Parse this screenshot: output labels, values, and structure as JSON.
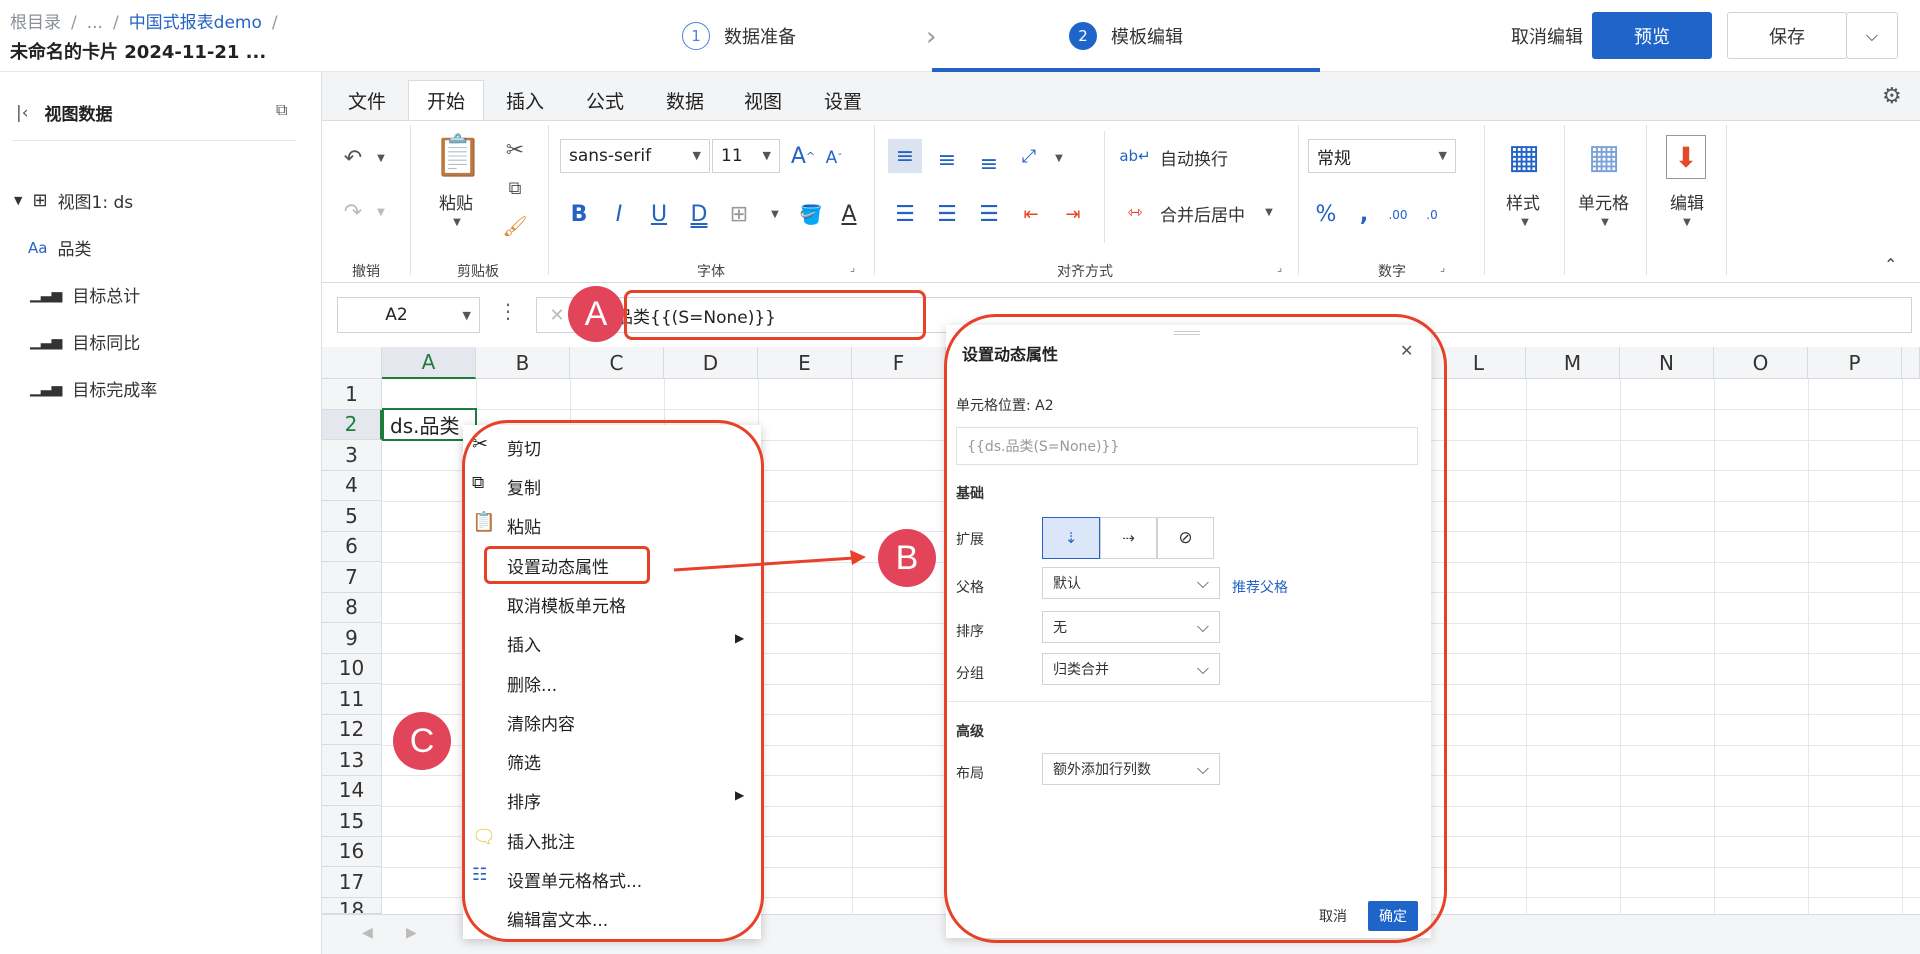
{
  "topbar": {
    "breadcrumb": [
      "根目录",
      "...",
      "中国式报表demo"
    ],
    "separator": "/",
    "title": "未命名的卡片 2024-11-21 ...",
    "steps": [
      {
        "num": "1",
        "label": "数据准备"
      },
      {
        "num": "2",
        "label": "模板编辑"
      }
    ],
    "cancel_edit": "取消编辑",
    "preview": "预览",
    "save": "保存"
  },
  "sidebar": {
    "title": "视图数据",
    "view_node": "视图1: ds",
    "fields": [
      "品类",
      "目标总计",
      "目标同比",
      "目标完成率"
    ]
  },
  "tabs": [
    "文件",
    "开始",
    "插入",
    "公式",
    "数据",
    "视图",
    "设置"
  ],
  "ribbon": {
    "undo_group": "撤销",
    "clipboard_group": "剪贴板",
    "paste": "粘贴",
    "font_group": "字体",
    "font_family": "sans-serif",
    "font_size": "11",
    "align_group": "对齐方式",
    "wrap_text": "自动换行",
    "merge_center": "合并后居中",
    "number_group": "数字",
    "number_format": "常规",
    "style": "样式",
    "cell": "单元格",
    "edit": "编辑"
  },
  "formula_bar": {
    "cell_ref": "A2",
    "formula": "ds.品类{{(S=None)}}"
  },
  "grid": {
    "columns": [
      "A",
      "B",
      "C",
      "D",
      "E",
      "F",
      "L",
      "M",
      "N",
      "O",
      "P"
    ],
    "rows": [
      "1",
      "2",
      "3",
      "4",
      "5",
      "6",
      "7",
      "8",
      "9",
      "10",
      "11",
      "12",
      "13",
      "14",
      "15",
      "16",
      "17",
      "18"
    ],
    "cell_a2": "ds.品类"
  },
  "context_menu": [
    "剪切",
    "复制",
    "粘贴",
    "设置动态属性",
    "取消模板单元格",
    "插入",
    "删除...",
    "清除内容",
    "筛选",
    "排序",
    "插入批注",
    "设置单元格格式...",
    "编辑富文本..."
  ],
  "dialog": {
    "title": "设置动态属性",
    "cell_position": "单元格位置: A2",
    "expression": "{{ds.品类(S=None)}}",
    "basic": "基础",
    "expand_label": "扩展",
    "parent_label": "父格",
    "parent_value": "默认",
    "recommend_parent": "推荐父格",
    "sort_label": "排序",
    "sort_value": "无",
    "group_label": "分组",
    "group_value": "归类合并",
    "advanced": "高级",
    "layout_label": "布局",
    "layout_value": "额外添加行列数",
    "cancel": "取消",
    "ok": "确定"
  },
  "annotations": [
    "A",
    "B",
    "C"
  ],
  "colors": {
    "accent": "#1f64c9",
    "highlight": "#e8412a",
    "badge": "#e2455a"
  }
}
